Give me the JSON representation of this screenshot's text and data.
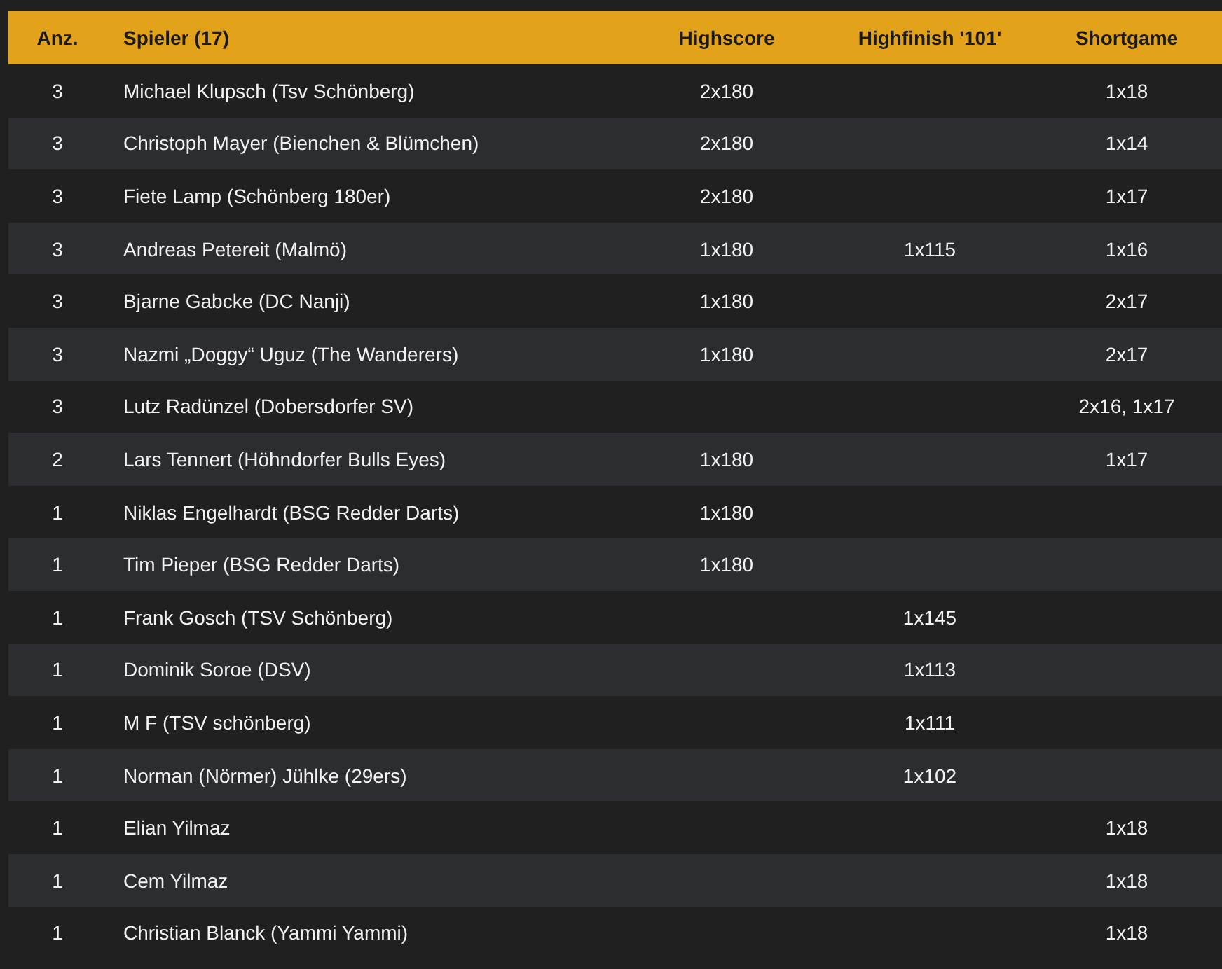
{
  "table": {
    "columns": [
      "Anz.",
      "Spieler (17)",
      "Highscore",
      "Highfinish '101'",
      "Shortgame"
    ],
    "rows": [
      {
        "count": "3",
        "player": "Michael Klupsch (Tsv Schönberg)",
        "highscore": "2x180",
        "shortgame": "1x18"
      },
      {
        "count": "3",
        "player": "Christoph Mayer (Bienchen & Blümchen)",
        "highscore": "2x180",
        "shortgame": "1x14"
      },
      {
        "count": "3",
        "player": "Fiete Lamp (Schönberg 180er)",
        "highscore": "2x180",
        "shortgame": "1x17"
      },
      {
        "count": "3",
        "player": "Andreas Petereit (Malmö)",
        "highscore": "1x180",
        "highfinish": "1x115",
        "shortgame": "1x16"
      },
      {
        "count": "3",
        "player": "Bjarne Gabcke (DC Nanji)",
        "highscore": "1x180",
        "shortgame": "2x17"
      },
      {
        "count": "3",
        "player": "Nazmi „Doggy“ Uguz (The Wanderers)",
        "highscore": "1x180",
        "shortgame": "2x17"
      },
      {
        "count": "3",
        "player": "Lutz Radünzel (Dobersdorfer SV)",
        "shortgame": "2x16, 1x17"
      },
      {
        "count": "2",
        "player": "Lars Tennert (Höhndorfer Bulls Eyes)",
        "highscore": "1x180",
        "shortgame": "1x17"
      },
      {
        "count": "1",
        "player": "Niklas Engelhardt (BSG Redder Darts)",
        "highscore": "1x180"
      },
      {
        "count": "1",
        "player": "Tim Pieper (BSG Redder Darts)",
        "highscore": "1x180"
      },
      {
        "count": "1",
        "player": "Frank Gosch (TSV Schönberg)",
        "highfinish": "1x145"
      },
      {
        "count": "1",
        "player": "Dominik Soroe (DSV)",
        "highfinish": "1x113"
      },
      {
        "count": "1",
        "player": "M F (TSV schönberg)",
        "highfinish": "1x111"
      },
      {
        "count": "1",
        "player": "Norman (Nörmer) Jühlke (29ers)",
        "highfinish": "1x102"
      },
      {
        "count": "1",
        "player": "Elian Yilmaz",
        "shortgame": "1x18"
      },
      {
        "count": "1",
        "player": "Cem Yilmaz",
        "shortgame": "1x18"
      },
      {
        "count": "1",
        "player": "Christian Blanck (Yammi Yammi)",
        "shortgame": "1x18"
      }
    ]
  }
}
